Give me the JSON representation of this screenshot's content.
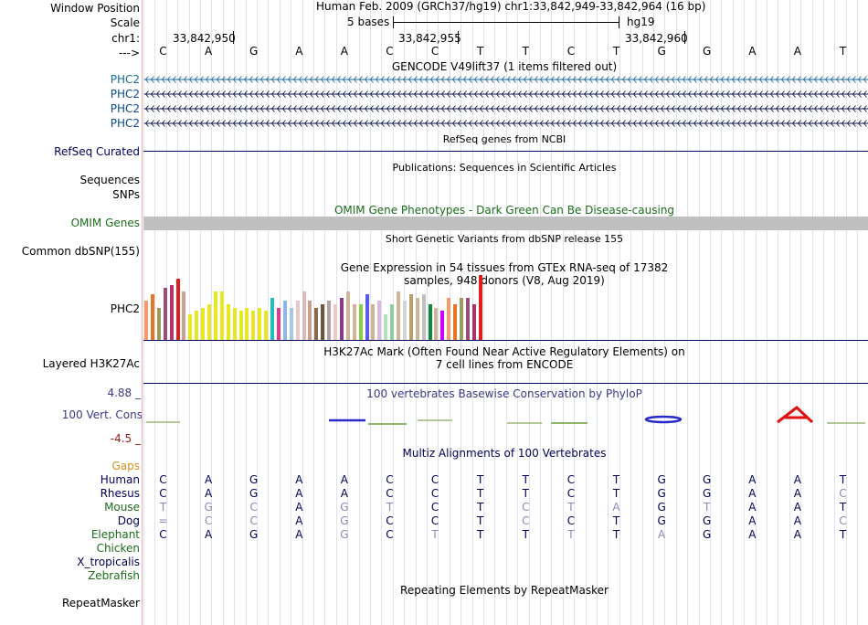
{
  "header": {
    "window_position_label": "Window Position",
    "scale_label": "Scale",
    "chr_label": "chr1:",
    "strand_label": "--->",
    "position_text": "Human Feb. 2009 (GRCh37/hg19)   chr1:33,842,949-33,842,964 (16 bp)",
    "scale_text": "5 bases",
    "assembly": "hg19",
    "ticks": [
      "33,842,950",
      "33,842,955",
      "33,842,960"
    ]
  },
  "sequence": [
    "C",
    "A",
    "G",
    "A",
    "A",
    "C",
    "C",
    "T",
    "T",
    "C",
    "T",
    "G",
    "G",
    "A",
    "A",
    "T"
  ],
  "tracks": {
    "gencode_title": "GENCODE V49lift37 (1 items filtered out)",
    "gencode_genes": [
      "PHC2",
      "PHC2",
      "PHC2",
      "PHC2"
    ],
    "refseq_title": "RefSeq genes from NCBI",
    "refseq_label": "RefSeq Curated",
    "pubs_title": "Publications: Sequences in Scientific Articles",
    "sequences_label": "Sequences",
    "snps_label": "SNPs",
    "omim_title": "OMIM Gene Phenotypes - Dark Green Can Be Disease-causing",
    "omim_label": "OMIM Genes",
    "dbsnp_title": "Short Genetic Variants from dbSNP release 155",
    "dbsnp_label": "Common dbSNP(155)",
    "gtex_title": "Gene Expression in 54 tissues from GTEx RNA-seq of 17382 samples, 948 donors (V8, Aug 2019)",
    "gtex_label": "PHC2",
    "h3k27_title": "H3K27Ac Mark (Often Found Near Active Regulatory Elements) on 7 cell lines from ENCODE",
    "h3k27_label": "Layered H3K27Ac",
    "phylop_title": "100 vertebrates Basewise Conservation by PhyloP",
    "phylop_label": "100 Vert. Cons",
    "phylop_max": "4.88 _",
    "phylop_min": "-4.5 _",
    "multiz_title": "Multiz Alignments of 100 Vertebrates",
    "gaps_label": "Gaps",
    "repeat_title": "Repeating Elements by RepeatMasker",
    "repeat_label": "RepeatMasker"
  },
  "alignments": [
    {
      "species": "Human",
      "bases": [
        "C",
        "A",
        "G",
        "A",
        "A",
        "C",
        "C",
        "T",
        "T",
        "C",
        "T",
        "G",
        "G",
        "A",
        "A",
        "T"
      ]
    },
    {
      "species": "Rhesus",
      "bases": [
        "C",
        "A",
        "G",
        "A",
        "A",
        "C",
        "C",
        "T",
        "T",
        "C",
        "T",
        "G",
        "G",
        "A",
        "A",
        "C"
      ]
    },
    {
      "species": "Mouse",
      "bases": [
        "T",
        "G",
        "C",
        "A",
        "G",
        "T",
        "C",
        "T",
        "C",
        "T",
        "A",
        "G",
        "T",
        "A",
        "A",
        "T"
      ]
    },
    {
      "species": "Dog",
      "bases": [
        "=",
        "C",
        "C",
        "A",
        "G",
        "C",
        "C",
        "T",
        "C",
        "C",
        "T",
        "G",
        "G",
        "A",
        "A",
        "C"
      ]
    },
    {
      "species": "Elephant",
      "bases": [
        "C",
        "A",
        "G",
        "A",
        "G",
        "C",
        "T",
        "T",
        "T",
        "T",
        "T",
        "A",
        "G",
        "A",
        "A",
        "T"
      ]
    },
    {
      "species": "Chicken",
      "bases": []
    },
    {
      "species": "X_tropicalis",
      "bases": []
    },
    {
      "species": "Zebrafish",
      "bases": []
    }
  ],
  "gtex_expression": [
    12,
    14,
    10,
    16,
    17,
    19,
    15,
    8,
    9,
    10,
    11,
    15,
    15,
    11,
    10,
    9,
    10,
    9,
    10,
    9,
    13,
    10,
    12,
    10,
    12,
    15,
    12,
    10,
    11,
    12,
    11,
    13,
    15,
    11,
    11,
    14,
    11,
    12,
    8,
    11,
    15,
    12,
    14,
    13,
    14,
    11,
    10,
    9,
    13,
    11,
    13,
    13,
    11,
    20
  ],
  "colors": {
    "label_dark": "#00005a",
    "label_blue": "#0a4a8f",
    "gencode_blue": "#1a6aa0",
    "omim_green": "#1c6c1c",
    "gaps_orange": "#d4901c",
    "phylop_max": "#3a3a88",
    "phylop_min": "#9a1a1a",
    "mismatch": "#8a8ab8",
    "gtex_palette": [
      "#f59a68",
      "#e8762a",
      "#9b9b5a",
      "#9b4b79",
      "#b5306b",
      "#e21d1d",
      "#c4a48f",
      "#e8e820",
      "#e8e820",
      "#e8e820",
      "#e8e820",
      "#e8e820",
      "#e8e820",
      "#e8e820",
      "#e8e820",
      "#e8e820",
      "#e8e820",
      "#e8e820",
      "#e8e820",
      "#e8e820",
      "#22bdbd",
      "#e33a8a",
      "#8fb8e8",
      "#a5c8e8",
      "#e8c8c8",
      "#dcb8b8",
      "#cba08a",
      "#8a6a4a",
      "#6a5a3a",
      "#b5a0a0",
      "#f0c8c8",
      "#8a3a8a",
      "#cfb498",
      "#cfb498",
      "#8bcf40",
      "#5a5aee",
      "#cfb498",
      "#dcb8dc",
      "#b5e0b5",
      "#8acfa0",
      "#cfb498",
      "#d4d4d4",
      "#b5a070",
      "#cfb498",
      "#c0c0c0",
      "#0a8a3a",
      "#cfb498",
      "#cd00ff"
    ]
  }
}
